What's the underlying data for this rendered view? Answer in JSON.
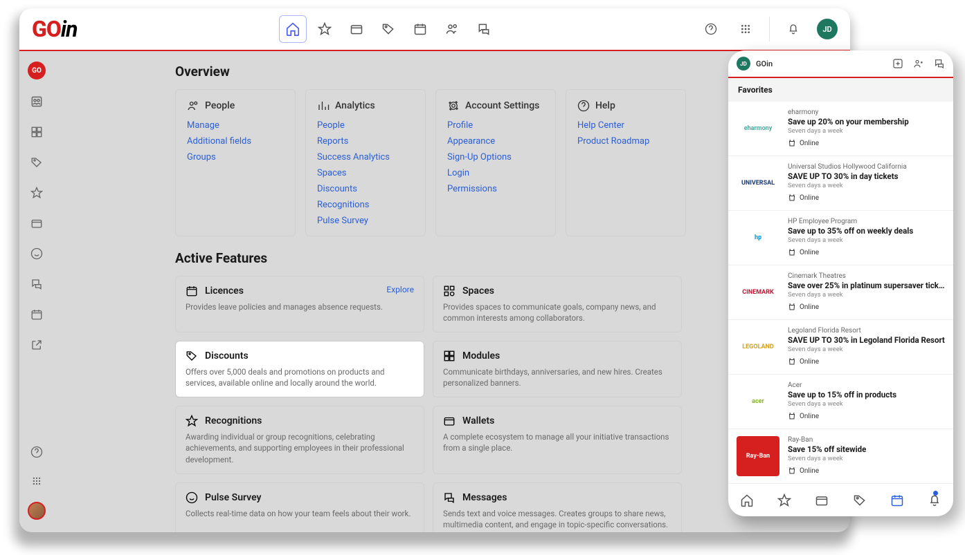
{
  "app": {
    "name": "GOin",
    "avatar": "JD"
  },
  "overview": {
    "title": "Overview",
    "cards": [
      {
        "title": "People",
        "links": [
          "Manage",
          "Additional fields",
          "Groups"
        ]
      },
      {
        "title": "Analytics",
        "links": [
          "People",
          "Reports",
          "Success Analytics",
          "Spaces",
          "Discounts",
          "Recognitions",
          "Pulse Survey"
        ]
      },
      {
        "title": "Account Settings",
        "links": [
          "Profile",
          "Appearance",
          "Sign-Up Options",
          "Login",
          "Permissions"
        ]
      },
      {
        "title": "Help",
        "links": [
          "Help Center",
          "Product Roadmap"
        ]
      }
    ]
  },
  "features": {
    "title": "Active Features",
    "explore": "Explore",
    "items": [
      {
        "title": "Licences",
        "desc": "Provides leave policies and manages absence requests."
      },
      {
        "title": "Spaces",
        "desc": "Provides spaces to communicate goals, company news, and common interests among collaborators."
      },
      {
        "title": "Discounts",
        "desc": "Offers over 5,000 deals and promotions on products and services, available online and locally around the world."
      },
      {
        "title": "Modules",
        "desc": "Communicate birthdays, anniversaries, and new hires. Creates personalized banners."
      },
      {
        "title": "Recognitions",
        "desc": "Awarding individual or group recognitions, celebrating achievements, and supporting employees in their professional development."
      },
      {
        "title": "Wallets",
        "desc": "A complete ecosystem to manage all your initiative transactions from a single place."
      },
      {
        "title": "Pulse Survey",
        "desc": "Collects real-time data on how your team feels about their work."
      },
      {
        "title": "Messages",
        "desc": "Sends text and voice messages. Creates groups to share news, multimedia content, and engage in topic-specific conversations."
      }
    ]
  },
  "mobile": {
    "appname": "GOin",
    "section": "Favorites",
    "online": "Online",
    "days": "Seven days a week",
    "items": [
      {
        "brand": "eharmony",
        "deal": "Save up 20% on your membership",
        "logo_text": "eharmony",
        "logo_bg": "#fff",
        "logo_color": "#4aa89e"
      },
      {
        "brand": "Universal Studios Hollywood California",
        "deal": "SAVE UP TO 30% in day tickets",
        "logo_text": "UNIVERSAL",
        "logo_bg": "#fff",
        "logo_color": "#1a3a7a"
      },
      {
        "brand": "HP Employee Program",
        "deal": "Save up to 35% off on weekly deals",
        "logo_text": "hp",
        "logo_bg": "#fff",
        "logo_color": "#0096d6"
      },
      {
        "brand": "Cinemark Theatres",
        "deal": "Save over 25% in platinum supersaver tick...",
        "logo_text": "CINEMARK",
        "logo_bg": "#fff",
        "logo_color": "#c41230"
      },
      {
        "brand": "Legoland Florida Resort",
        "deal": "SAVE UP TO 30% in Legoland Florida Resort",
        "logo_text": "LEGOLAND",
        "logo_bg": "#fff",
        "logo_color": "#d4a017"
      },
      {
        "brand": "Acer",
        "deal": "Save up to 15% off in products",
        "logo_text": "acer",
        "logo_bg": "#fff",
        "logo_color": "#83b81a"
      },
      {
        "brand": "Ray-Ban",
        "deal": "Save 15% off sitewide",
        "logo_text": "Ray-Ban",
        "logo_bg": "#d62020",
        "logo_color": "#fff"
      }
    ]
  }
}
